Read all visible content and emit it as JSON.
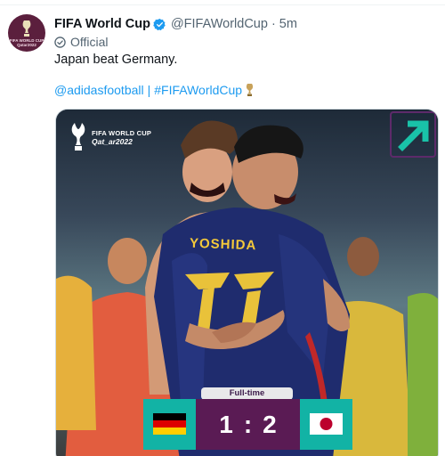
{
  "tweet": {
    "author_name": "FIFA World Cup",
    "handle": "@FIFAWorldCup",
    "separator": "·",
    "time": "5m",
    "affiliation": "Official",
    "text": "Japan beat Germany.",
    "hashtag_link_1": "@adidasfootball",
    "link_separator": "|",
    "hashtag_link_2": "#FIFAWorldCup",
    "avatar_text": "FIFA WORLD CUP Qatar2022"
  },
  "media": {
    "logo_line1": "FIFA WORLD CUP",
    "logo_line2": "Qat_ar2022",
    "jersey_name": "YOSHIDA",
    "status": "Full-time",
    "home_score": "1",
    "score_separator": ":",
    "away_score": "2"
  },
  "colors": {
    "link": "#1d9bf0",
    "verified": "#1d9bf0",
    "score_bg": "#5a1b54",
    "team_bg": "#12b3a5"
  },
  "icons": {
    "verified": "verified-badge-icon",
    "official": "official-check-icon",
    "trophy": "trophy-icon",
    "arrow": "arrow-up-right-icon",
    "flag_left": "germany-flag-icon",
    "flag_right": "japan-flag-icon"
  }
}
